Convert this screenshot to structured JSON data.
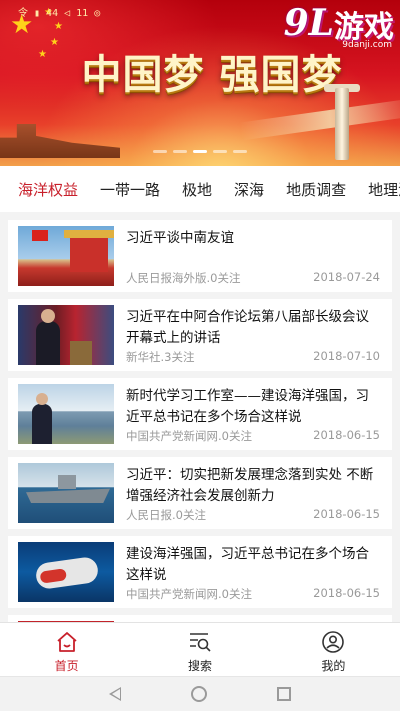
{
  "banner": {
    "title": "中国梦 强国梦",
    "watermark_number": "9L",
    "watermark_text": "游戏",
    "watermark_url": "9danji.com",
    "status_text": "令 ▮ 44 ◁ 11 ◎",
    "slides": 5,
    "active_slide": 2
  },
  "tabs": [
    {
      "label": "海洋权益",
      "active": true
    },
    {
      "label": "一带一路",
      "active": false
    },
    {
      "label": "极地",
      "active": false
    },
    {
      "label": "深海",
      "active": false
    },
    {
      "label": "地质调查",
      "active": false
    },
    {
      "label": "地理测",
      "active": false
    }
  ],
  "articles": [
    {
      "title": "习近平谈中南友谊",
      "source": "人民日报海外版.0关注",
      "date": "2018-07-24",
      "thumb": "tiananmen-photo"
    },
    {
      "title": "习近平在中阿合作论坛第八届部长级会议开幕式上的讲话",
      "source": "新华社.3关注",
      "date": "2018-07-10",
      "thumb": "speech-photo"
    },
    {
      "title": "新时代学习工作室——建设海洋强国，习近平总书记在多个场合这样说",
      "source": "中国共产党新闻网.0关注",
      "date": "2018-06-15",
      "thumb": "coast-photo"
    },
    {
      "title": "习近平：切实把新发展理念落到实处 不断增强经济社会发展创新力",
      "source": "人民日报.0关注",
      "date": "2018-06-15",
      "thumb": "warship-photo"
    },
    {
      "title": "建设海洋强国，习近平总书记在多个场合这样说",
      "source": "中国共产党新闻网.0关注",
      "date": "2018-06-15",
      "thumb": "submersible-photo"
    }
  ],
  "bottom_nav": [
    {
      "label": "首页",
      "icon": "home-icon",
      "active": true
    },
    {
      "label": "搜索",
      "icon": "search-list-icon",
      "active": false
    },
    {
      "label": "我的",
      "icon": "user-icon",
      "active": false
    }
  ],
  "colors": {
    "accent": "#c8202b",
    "banner_red": "#d61420",
    "text_gray": "#9a9a9a"
  }
}
